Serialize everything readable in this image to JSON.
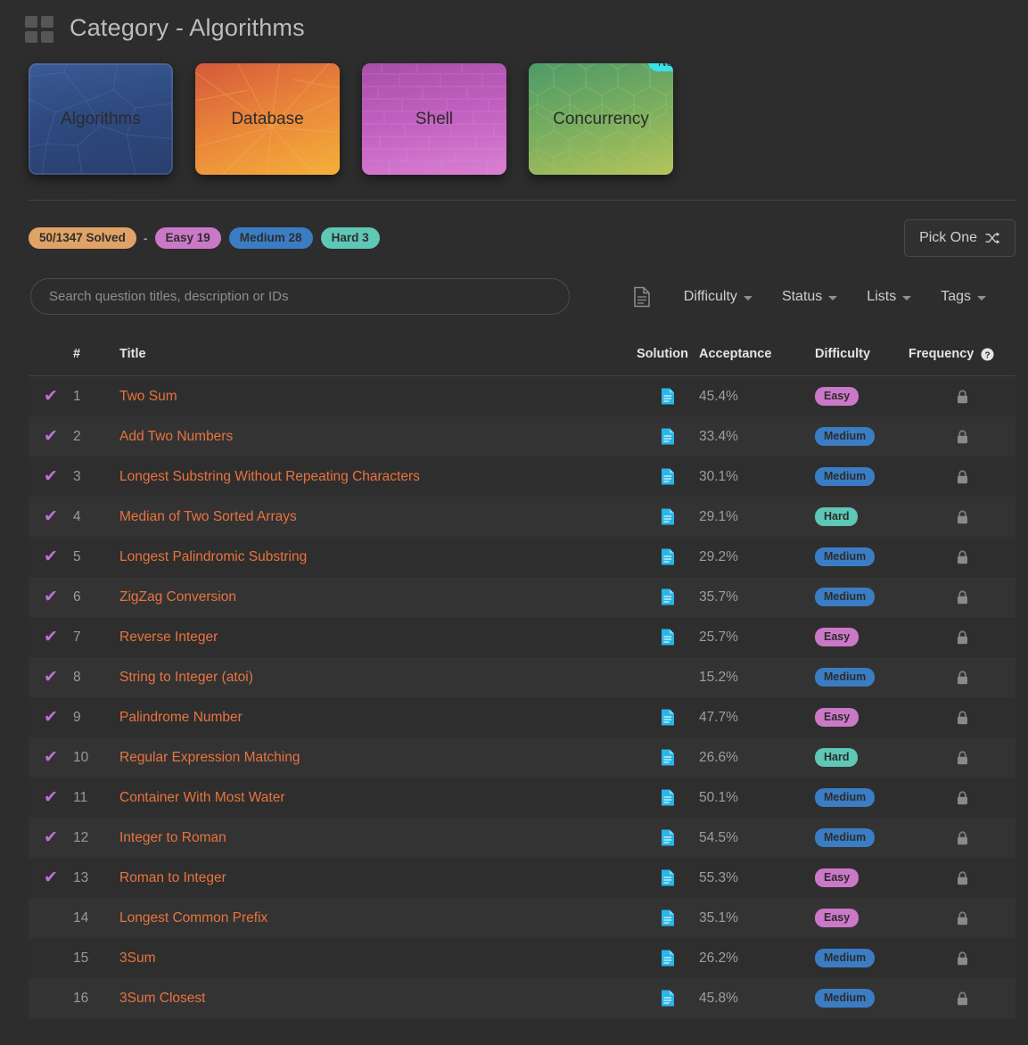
{
  "header": {
    "title": "Category - Algorithms",
    "grid_icon": "grid-icon"
  },
  "categories": [
    {
      "label": "Algorithms",
      "selected": true,
      "badge": null,
      "theme": "c-alg"
    },
    {
      "label": "Database",
      "selected": false,
      "badge": null,
      "theme": "c-db"
    },
    {
      "label": "Shell",
      "selected": false,
      "badge": null,
      "theme": "c-sh"
    },
    {
      "label": "Concurrency",
      "selected": false,
      "badge": "New",
      "theme": "c-cc"
    }
  ],
  "stats": {
    "solved": "50/1347 Solved",
    "separator": "-",
    "easy": "Easy 19",
    "medium": "Medium 28",
    "hard": "Hard 3",
    "pick_one": "Pick One",
    "shuffle_icon": "shuffle-icon"
  },
  "search": {
    "value": "",
    "placeholder": "Search question titles, description or IDs"
  },
  "filters": {
    "doc_icon": "document-icon",
    "items": [
      {
        "label": "Difficulty"
      },
      {
        "label": "Status"
      },
      {
        "label": "Lists"
      },
      {
        "label": "Tags"
      }
    ]
  },
  "table": {
    "columns": {
      "check": "",
      "num": "#",
      "title": "Title",
      "solution": "Solution",
      "acceptance": "Acceptance",
      "difficulty": "Difficulty",
      "frequency": "Frequency"
    },
    "help_icon": "help-circle-icon",
    "rows": [
      {
        "solved": true,
        "num": "1",
        "title": "Two Sum",
        "solution": true,
        "acceptance": "45.4%",
        "difficulty": "Easy",
        "locked": true
      },
      {
        "solved": true,
        "num": "2",
        "title": "Add Two Numbers",
        "solution": true,
        "acceptance": "33.4%",
        "difficulty": "Medium",
        "locked": true
      },
      {
        "solved": true,
        "num": "3",
        "title": "Longest Substring Without Repeating Characters",
        "solution": true,
        "acceptance": "30.1%",
        "difficulty": "Medium",
        "locked": true
      },
      {
        "solved": true,
        "num": "4",
        "title": "Median of Two Sorted Arrays",
        "solution": true,
        "acceptance": "29.1%",
        "difficulty": "Hard",
        "locked": true
      },
      {
        "solved": true,
        "num": "5",
        "title": "Longest Palindromic Substring",
        "solution": true,
        "acceptance": "29.2%",
        "difficulty": "Medium",
        "locked": true
      },
      {
        "solved": true,
        "num": "6",
        "title": "ZigZag Conversion",
        "solution": true,
        "acceptance": "35.7%",
        "difficulty": "Medium",
        "locked": true
      },
      {
        "solved": true,
        "num": "7",
        "title": "Reverse Integer",
        "solution": true,
        "acceptance": "25.7%",
        "difficulty": "Easy",
        "locked": true
      },
      {
        "solved": true,
        "num": "8",
        "title": "String to Integer (atoi)",
        "solution": false,
        "acceptance": "15.2%",
        "difficulty": "Medium",
        "locked": true
      },
      {
        "solved": true,
        "num": "9",
        "title": "Palindrome Number",
        "solution": true,
        "acceptance": "47.7%",
        "difficulty": "Easy",
        "locked": true
      },
      {
        "solved": true,
        "num": "10",
        "title": "Regular Expression Matching",
        "solution": true,
        "acceptance": "26.6%",
        "difficulty": "Hard",
        "locked": true
      },
      {
        "solved": true,
        "num": "11",
        "title": "Container With Most Water",
        "solution": true,
        "acceptance": "50.1%",
        "difficulty": "Medium",
        "locked": true
      },
      {
        "solved": true,
        "num": "12",
        "title": "Integer to Roman",
        "solution": true,
        "acceptance": "54.5%",
        "difficulty": "Medium",
        "locked": true
      },
      {
        "solved": true,
        "num": "13",
        "title": "Roman to Integer",
        "solution": true,
        "acceptance": "55.3%",
        "difficulty": "Easy",
        "locked": true
      },
      {
        "solved": false,
        "num": "14",
        "title": "Longest Common Prefix",
        "solution": true,
        "acceptance": "35.1%",
        "difficulty": "Easy",
        "locked": true
      },
      {
        "solved": false,
        "num": "15",
        "title": "3Sum",
        "solution": true,
        "acceptance": "26.2%",
        "difficulty": "Medium",
        "locked": true
      },
      {
        "solved": false,
        "num": "16",
        "title": "3Sum Closest",
        "solution": true,
        "acceptance": "45.8%",
        "difficulty": "Medium",
        "locked": true
      }
    ]
  },
  "colors": {
    "background": "#2d2d2d",
    "title_link": "#e8733f",
    "check": "#c071d6",
    "easy": "#cc78c8",
    "medium": "#3b7dc4",
    "hard": "#5ec7b6",
    "solved_pill": "#e0a266",
    "new_badge": "#3ae1e8",
    "solution_icon": "#29b6e8"
  }
}
